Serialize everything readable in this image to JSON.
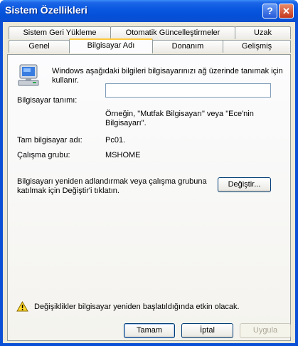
{
  "window": {
    "title": "Sistem Özellikleri",
    "help_glyph": "?",
    "close_glyph": "✕"
  },
  "tabs_row1": [
    "Sistem Geri Yükleme",
    "Otomatik Güncelleştirmeler",
    "Uzak"
  ],
  "tabs_row2": [
    "Genel",
    "Bilgisayar Adı",
    "Donanım",
    "Gelişmiş"
  ],
  "content": {
    "description_line1": "Windows aşağıdaki bilgileri bilgisayarınızı ağ üzerinde tanımak için",
    "description_line2": "kullanır.",
    "computer_description_label": "Bilgisayar tanımı:",
    "computer_description_value": "",
    "example_line1": "Örneğin, \"Mutfak Bilgisayarı\" veya \"Ece'nin",
    "example_line2": "Bilgisayarı\".",
    "full_name_label": "Tam bilgisayar adı:",
    "full_name_value": "Pc01.",
    "workgroup_label": "Çalışma grubu:",
    "workgroup_value": "MSHOME",
    "rename_line1": "Bilgisayarı yeniden adlandırmak veya çalışma grubuna",
    "rename_line2": "katılmak için Değiştir'i tıklatın.",
    "change_button": "Değiştir...",
    "warning_text": "Değişiklikler bilgisayar yeniden  başlatıldığında etkin olacak."
  },
  "buttons": {
    "ok": "Tamam",
    "cancel": "İptal",
    "apply": "Uygula"
  },
  "colors": {
    "titlebar": "#0a58e0",
    "dialog_bg": "#ece9d8",
    "active_tab_accent": "#ffc83c"
  }
}
